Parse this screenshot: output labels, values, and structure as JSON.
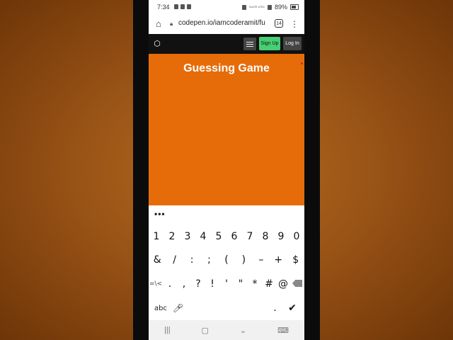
{
  "status_bar": {
    "time": "7:34",
    "battery": "89%",
    "network": "VoLTE LTE1"
  },
  "browser": {
    "url": "codepen.io/iamcoderamit/fu",
    "tab_count": "14"
  },
  "codepen": {
    "sign_up": "Sign Up",
    "log_in": "Log In"
  },
  "preview": {
    "title": "Guessing Game",
    "background": "#e66c0a"
  },
  "keyboard": {
    "more": "•••",
    "row1": [
      "1",
      "2",
      "3",
      "4",
      "5",
      "6",
      "7",
      "8",
      "9",
      "0"
    ],
    "row2": [
      "&",
      "/",
      ":",
      ";",
      "(",
      ")",
      "–",
      "+",
      "$"
    ],
    "row3": [
      "=\\<",
      ".",
      ",",
      "?",
      "!",
      "'",
      "\"",
      "*",
      "#",
      "@"
    ],
    "bottom": {
      "mode_key": "abc",
      "period": "."
    }
  },
  "colors": {
    "codepen_header": "#111111",
    "signup_green": "#47cf73"
  }
}
